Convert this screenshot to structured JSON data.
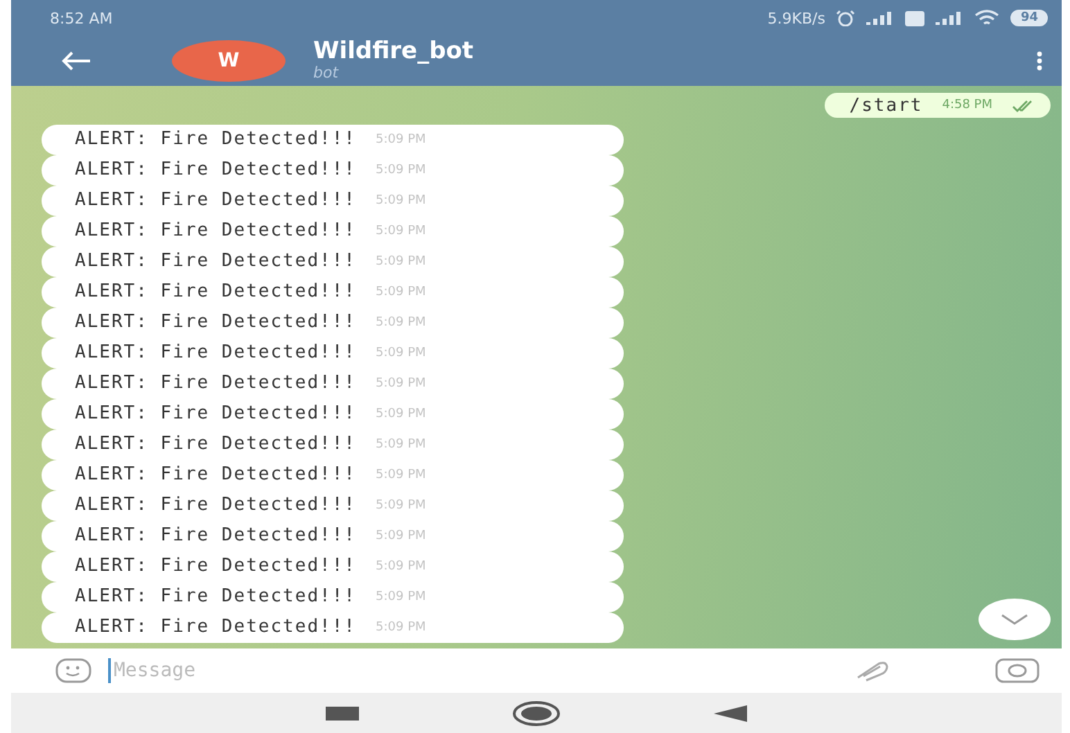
{
  "status_bar": {
    "time": "8:52 AM",
    "network_speed": "5.9KB/s",
    "battery": "94"
  },
  "header": {
    "avatar_letter": "W",
    "title": "Wildfire_bot",
    "subtitle": "bot"
  },
  "messages": [
    {
      "kind": "outgoing",
      "text": "/start",
      "time": "4:58 PM",
      "read": true
    },
    {
      "kind": "incoming",
      "text": "ALERT: Fire Detected!!!",
      "time": "5:09 PM"
    },
    {
      "kind": "incoming",
      "text": "ALERT: Fire Detected!!!",
      "time": "5:09 PM"
    },
    {
      "kind": "incoming",
      "text": "ALERT: Fire Detected!!!",
      "time": "5:09 PM"
    },
    {
      "kind": "incoming",
      "text": "ALERT: Fire Detected!!!",
      "time": "5:09 PM"
    },
    {
      "kind": "incoming",
      "text": "ALERT: Fire Detected!!!",
      "time": "5:09 PM"
    },
    {
      "kind": "incoming",
      "text": "ALERT: Fire Detected!!!",
      "time": "5:09 PM"
    },
    {
      "kind": "incoming",
      "text": "ALERT: Fire Detected!!!",
      "time": "5:09 PM"
    },
    {
      "kind": "incoming",
      "text": "ALERT: Fire Detected!!!",
      "time": "5:09 PM"
    },
    {
      "kind": "incoming",
      "text": "ALERT: Fire Detected!!!",
      "time": "5:09 PM"
    },
    {
      "kind": "incoming",
      "text": "ALERT: Fire Detected!!!",
      "time": "5:09 PM"
    },
    {
      "kind": "incoming",
      "text": "ALERT: Fire Detected!!!",
      "time": "5:09 PM"
    },
    {
      "kind": "incoming",
      "text": "ALERT: Fire Detected!!!",
      "time": "5:09 PM"
    },
    {
      "kind": "incoming",
      "text": "ALERT: Fire Detected!!!",
      "time": "5:09 PM"
    },
    {
      "kind": "incoming",
      "text": "ALERT: Fire Detected!!!",
      "time": "5:09 PM"
    },
    {
      "kind": "incoming",
      "text": "ALERT: Fire Detected!!!",
      "time": "5:09 PM"
    },
    {
      "kind": "incoming",
      "text": "ALERT: Fire Detected!!!",
      "time": "5:09 PM"
    },
    {
      "kind": "incoming",
      "text": "ALERT: Fire Detected!!!",
      "time": "5:09 PM"
    }
  ],
  "composer": {
    "placeholder": "Message"
  }
}
